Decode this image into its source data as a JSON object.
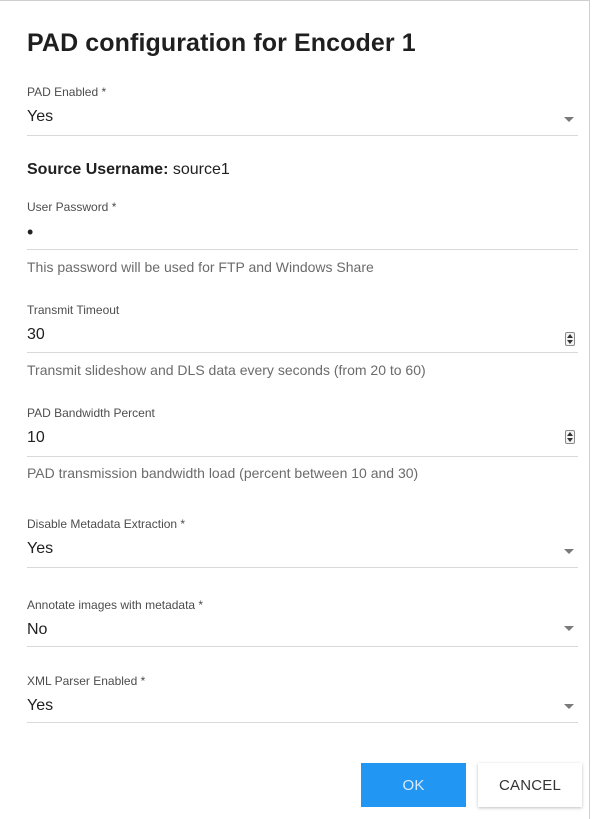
{
  "dialog": {
    "title": "PAD configuration for Encoder 1"
  },
  "fields": {
    "pad_enabled": {
      "label": "PAD Enabled *",
      "value": "Yes"
    },
    "source_username": {
      "label": "Source Username:",
      "value": "source1"
    },
    "user_password": {
      "label": "User Password *",
      "value": "•",
      "helper": "This password will be used for FTP and Windows Share"
    },
    "transmit_timeout": {
      "label": "Transmit Timeout",
      "value": "30",
      "helper": "Transmit slideshow and DLS data every seconds (from 20 to 60)"
    },
    "pad_bandwidth": {
      "label": "PAD Bandwidth Percent",
      "value": "10",
      "helper": "PAD transmission bandwidth load (percent between 10 and 30)"
    },
    "disable_metadata": {
      "label": "Disable Metadata Extraction *",
      "value": "Yes"
    },
    "annotate_images": {
      "label": "Annotate images with metadata *",
      "value": "No"
    },
    "xml_parser": {
      "label": "XML Parser Enabled *",
      "value": "Yes"
    }
  },
  "buttons": {
    "ok": "OK",
    "cancel": "CANCEL"
  },
  "colors": {
    "primary": "#2196f3",
    "underline": "#d9d9d9",
    "helper_text": "#6b6b6b"
  }
}
